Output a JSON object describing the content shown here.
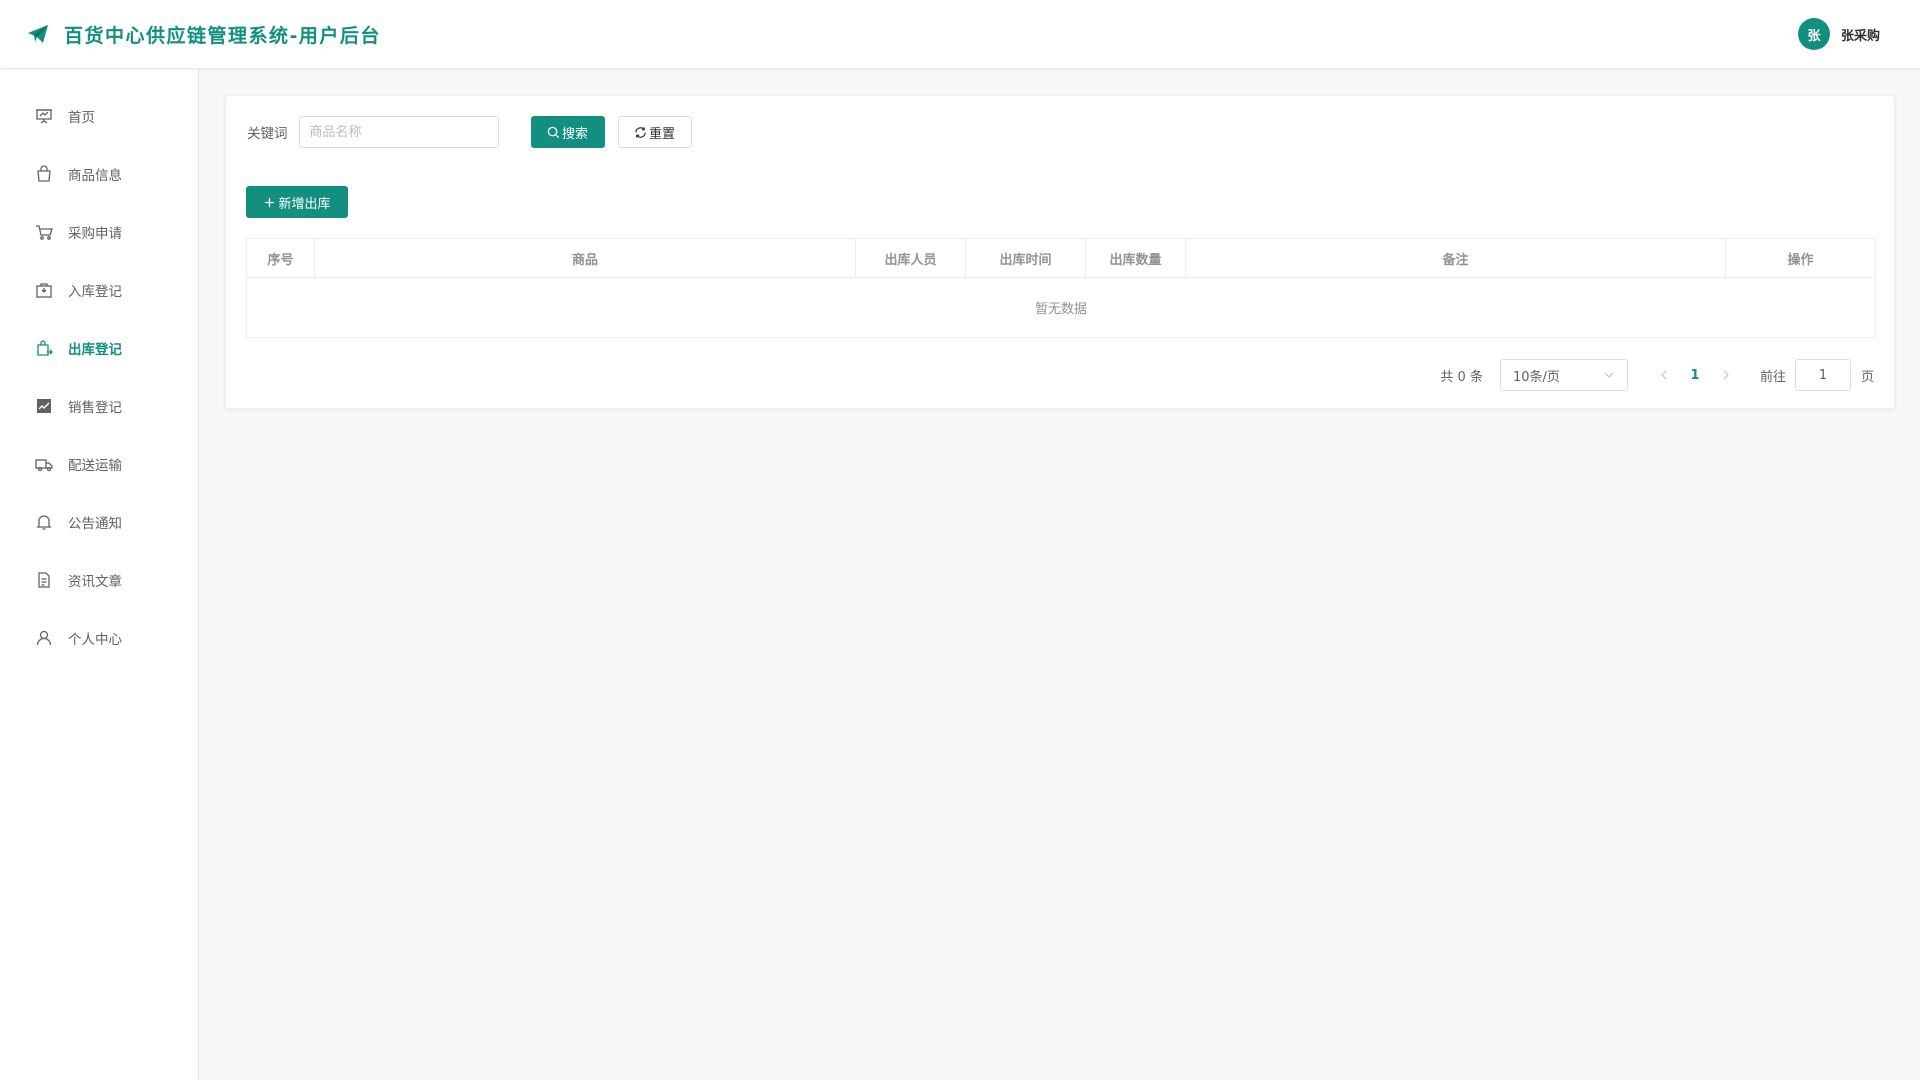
{
  "header": {
    "title": "百货中心供应链管理系统-用户后台",
    "user_avatar_text": "张",
    "user_name": "张采购",
    "accent_color": "#138f80"
  },
  "sidebar": {
    "items": [
      {
        "label": "首页",
        "icon": "presentation-icon",
        "active": false
      },
      {
        "label": "商品信息",
        "icon": "shopping-bag-icon",
        "active": false
      },
      {
        "label": "采购申请",
        "icon": "shopping-cart-icon",
        "active": false
      },
      {
        "label": "入库登记",
        "icon": "inbox-box-icon",
        "active": false
      },
      {
        "label": "出库登记",
        "icon": "outbound-box-icon",
        "active": true
      },
      {
        "label": "销售登记",
        "icon": "sales-chart-icon",
        "active": false
      },
      {
        "label": "配送运输",
        "icon": "truck-icon",
        "active": false
      },
      {
        "label": "公告通知",
        "icon": "bell-icon",
        "active": false
      },
      {
        "label": "资讯文章",
        "icon": "document-icon",
        "active": false
      },
      {
        "label": "个人中心",
        "icon": "user-icon",
        "active": false
      }
    ]
  },
  "search": {
    "label": "关键词",
    "placeholder": "商品名称",
    "value": "",
    "search_button": "搜索",
    "reset_button": "重置"
  },
  "actions": {
    "add_button": "新增出库"
  },
  "table": {
    "columns": [
      "序号",
      "商品",
      "出库人员",
      "出库时间",
      "出库数量",
      "备注",
      "操作"
    ],
    "rows": [],
    "empty_text": "暂无数据"
  },
  "pagination": {
    "total_text": "共 0 条",
    "page_size": "10条/页",
    "current_page": "1",
    "goto_label": "前往",
    "goto_value": "1",
    "goto_suffix": "页"
  }
}
